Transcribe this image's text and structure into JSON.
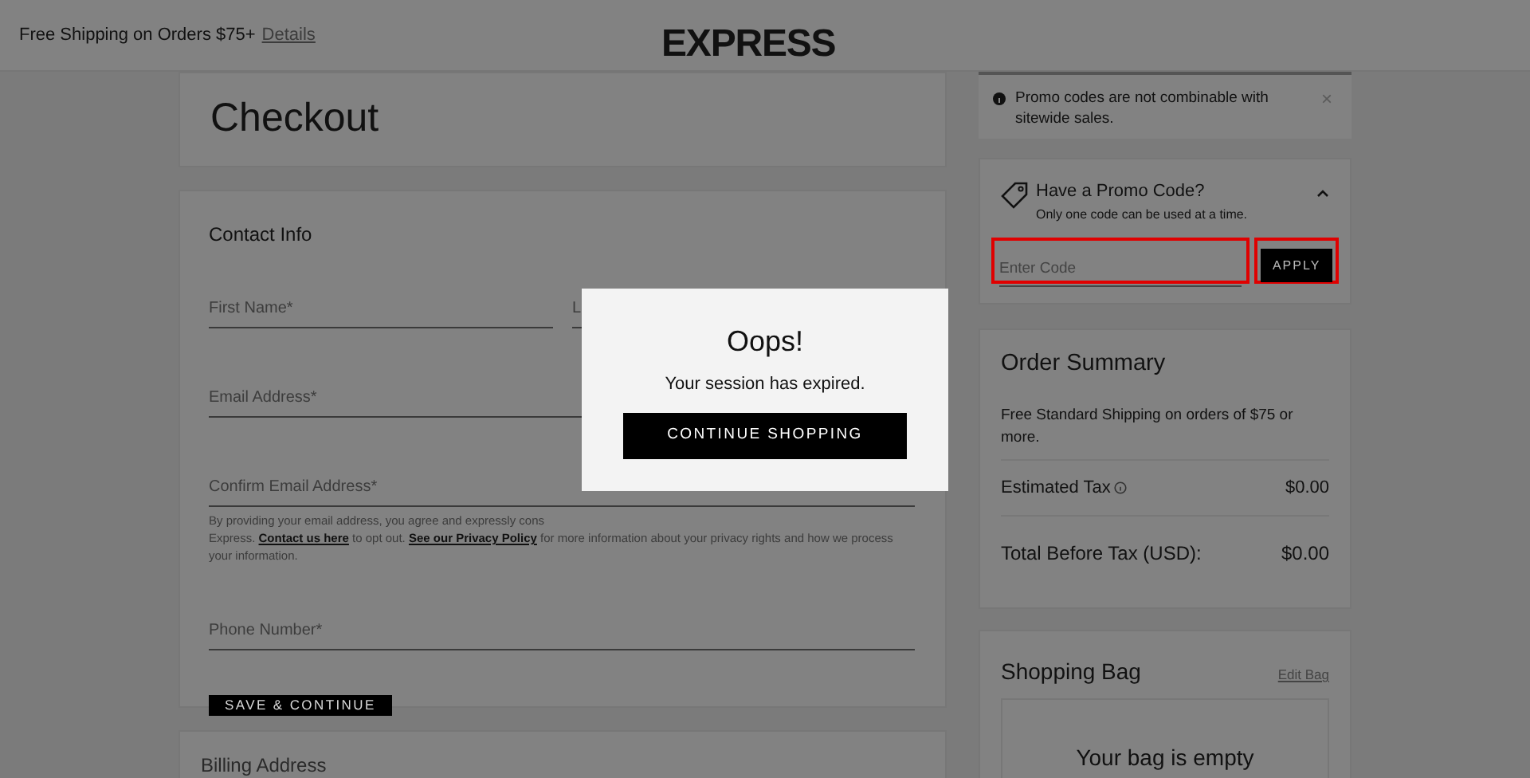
{
  "header": {
    "promo_text": "Free Shipping on Orders $75+",
    "promo_link": "Details",
    "logo": "EXPRESS"
  },
  "checkout": {
    "title": "Checkout"
  },
  "contact_info": {
    "title": "Contact Info",
    "fields": [
      {
        "placeholder": "First Name*"
      },
      {
        "placeholder": "L"
      }
    ],
    "email": {
      "placeholder": "Email Address*"
    },
    "confirm_email": {
      "placeholder": "Confirm Email Address*"
    },
    "consent_line_1": "By providing your email address, you agree and expressly cons",
    "consent_start": "Express. ",
    "consent_link_1": "Contact us here",
    "consent_middle": " to opt out. ",
    "consent_link_2": "See our Privacy Policy",
    "consent_end": " for more information about your privacy rights and how we process your information.",
    "phone": {
      "placeholder": "Phone Number*"
    },
    "button": "SAVE & CONTINUE"
  },
  "billing": {
    "title": "Billing Address"
  },
  "notice": {
    "text": "Promo codes are not combinable with sitewide sales.",
    "close": "×"
  },
  "promo": {
    "title": "Have a Promo Code?",
    "subtitle": "Only one code can be used at a time.",
    "expanded": true,
    "input": {
      "placeholder": "Enter Code",
      "highlighted": true
    },
    "button": {
      "label": "APPLY",
      "highlighted": true
    }
  },
  "order_summary": {
    "title": "Order Summary",
    "shipping_note": "Free Standard Shipping on orders of $75 or more.",
    "rows": [
      {
        "label": "Estimated Tax",
        "value": "$0.00",
        "info": true
      },
      {
        "label": "Total Before Tax (USD):",
        "value": "$0.00",
        "info": false
      }
    ]
  },
  "shopping_bag": {
    "title": "Shopping Bag",
    "edit_link": "Edit Bag",
    "empty_text": "Your bag is empty"
  },
  "modal": {
    "title": "Oops!",
    "message": "Your session has expired.",
    "button": "CONTINUE SHOPPING"
  }
}
